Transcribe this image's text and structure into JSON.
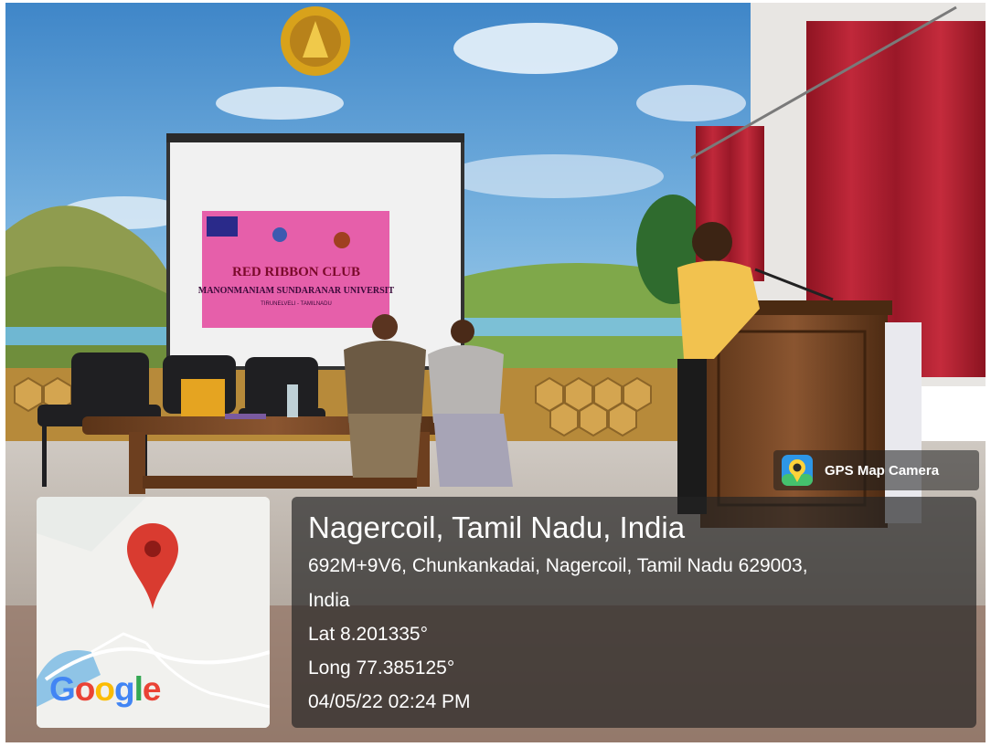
{
  "photo": {
    "description": "Indoor event stage with a speaker at a wooden podium, two seated women, chairs and a banner on a screen",
    "banner": {
      "title": "RED RIBBON CLUB",
      "university": "MANONMANIAM SUNDARANAR UNIVERSIT",
      "place": "TIRUNELVELI - TAMILNADU"
    }
  },
  "overlay": {
    "app_label": "GPS Map Camera",
    "place": "Nagercoil, Tamil Nadu, India",
    "address_line1": "692M+9V6, Chunkankadai, Nagercoil, Tamil Nadu 629003,",
    "address_line2": "India",
    "lat": "Lat 8.201335°",
    "long": "Long 77.385125°",
    "datetime": "04/05/22 02:24 PM",
    "map_brand": "Google"
  },
  "colors": {
    "sky": "#5a9fd6",
    "curtain": "#b31e2d",
    "banner": "#e0509e",
    "pin": "#d93b30"
  }
}
